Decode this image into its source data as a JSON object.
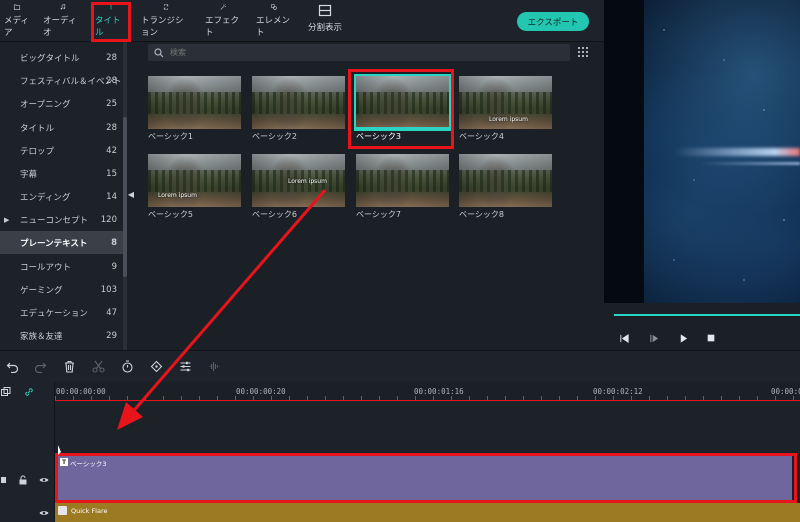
{
  "toolbar": {
    "tools": [
      {
        "id": "media",
        "label": "メディア",
        "icon": "folder-icon"
      },
      {
        "id": "audio",
        "label": "オーディオ",
        "icon": "music-note-icon"
      },
      {
        "id": "titles",
        "label": "タイトル",
        "icon": "text-t-icon",
        "active": true
      },
      {
        "id": "transitions",
        "label": "トランジション",
        "icon": "transition-icon"
      },
      {
        "id": "effects",
        "label": "エフェクト",
        "icon": "effects-icon"
      },
      {
        "id": "elements",
        "label": "エレメント",
        "icon": "elements-icon"
      },
      {
        "id": "split",
        "label": "分割表示",
        "icon": "split-screen-icon"
      }
    ],
    "export_label": "エクスポート"
  },
  "categories": [
    {
      "label": "ビッグタイトル",
      "count": "28"
    },
    {
      "label": "フェスティバル＆イベント",
      "count": "28"
    },
    {
      "label": "オープニング",
      "count": "25"
    },
    {
      "label": "タイトル",
      "count": "28"
    },
    {
      "label": "テロップ",
      "count": "42"
    },
    {
      "label": "字幕",
      "count": "15"
    },
    {
      "label": "エンディング",
      "count": "14"
    },
    {
      "label": "ニューコンセプト",
      "count": "120",
      "expandable": true
    },
    {
      "label": "プレーンテキスト",
      "count": "8",
      "active": true
    },
    {
      "label": "コールアウト",
      "count": "9"
    },
    {
      "label": "ゲーミング",
      "count": "103"
    },
    {
      "label": "エデュケーション",
      "count": "47"
    },
    {
      "label": "家族＆友達",
      "count": "29"
    }
  ],
  "search": {
    "placeholder": "検索"
  },
  "thumbnails": [
    {
      "label": "ベーシック1",
      "overlay": ""
    },
    {
      "label": "ベーシック2",
      "overlay": ""
    },
    {
      "label": "ベーシック3",
      "overlay": "",
      "selected": true
    },
    {
      "label": "ベーシック4",
      "overlay": "Lorem ipsum"
    },
    {
      "label": "ベーシック5",
      "overlay": "Lorem ipsum"
    },
    {
      "label": "ベーシック6",
      "overlay": "Lorem ipsum"
    },
    {
      "label": "ベーシック7",
      "overlay": ""
    },
    {
      "label": "ベーシック8",
      "overlay": ""
    }
  ],
  "preview": {
    "controls": [
      "step-back-icon",
      "play-slow-icon",
      "play-icon",
      "stop-icon"
    ]
  },
  "timeline": {
    "tools": [
      "undo-icon",
      "redo-icon",
      "delete-icon",
      "scissors-icon",
      "timer-icon",
      "keyframe-icon",
      "adjust-icon",
      "audio-wave-icon"
    ],
    "ruler": [
      {
        "label": "00:00:00:00"
      },
      {
        "label": "00:00:00:20"
      },
      {
        "label": "00:00:01:16"
      },
      {
        "label": "00:00:02:12"
      },
      {
        "label": "00:00:03"
      }
    ],
    "title_clip_label": "ベーシック3",
    "flare_clip_label": "Quick Flare"
  },
  "colors": {
    "accent": "#2ad3c2",
    "highlight": "#e8141c",
    "title_clip": "#6f669e",
    "effect_clip": "#9c7a22"
  }
}
